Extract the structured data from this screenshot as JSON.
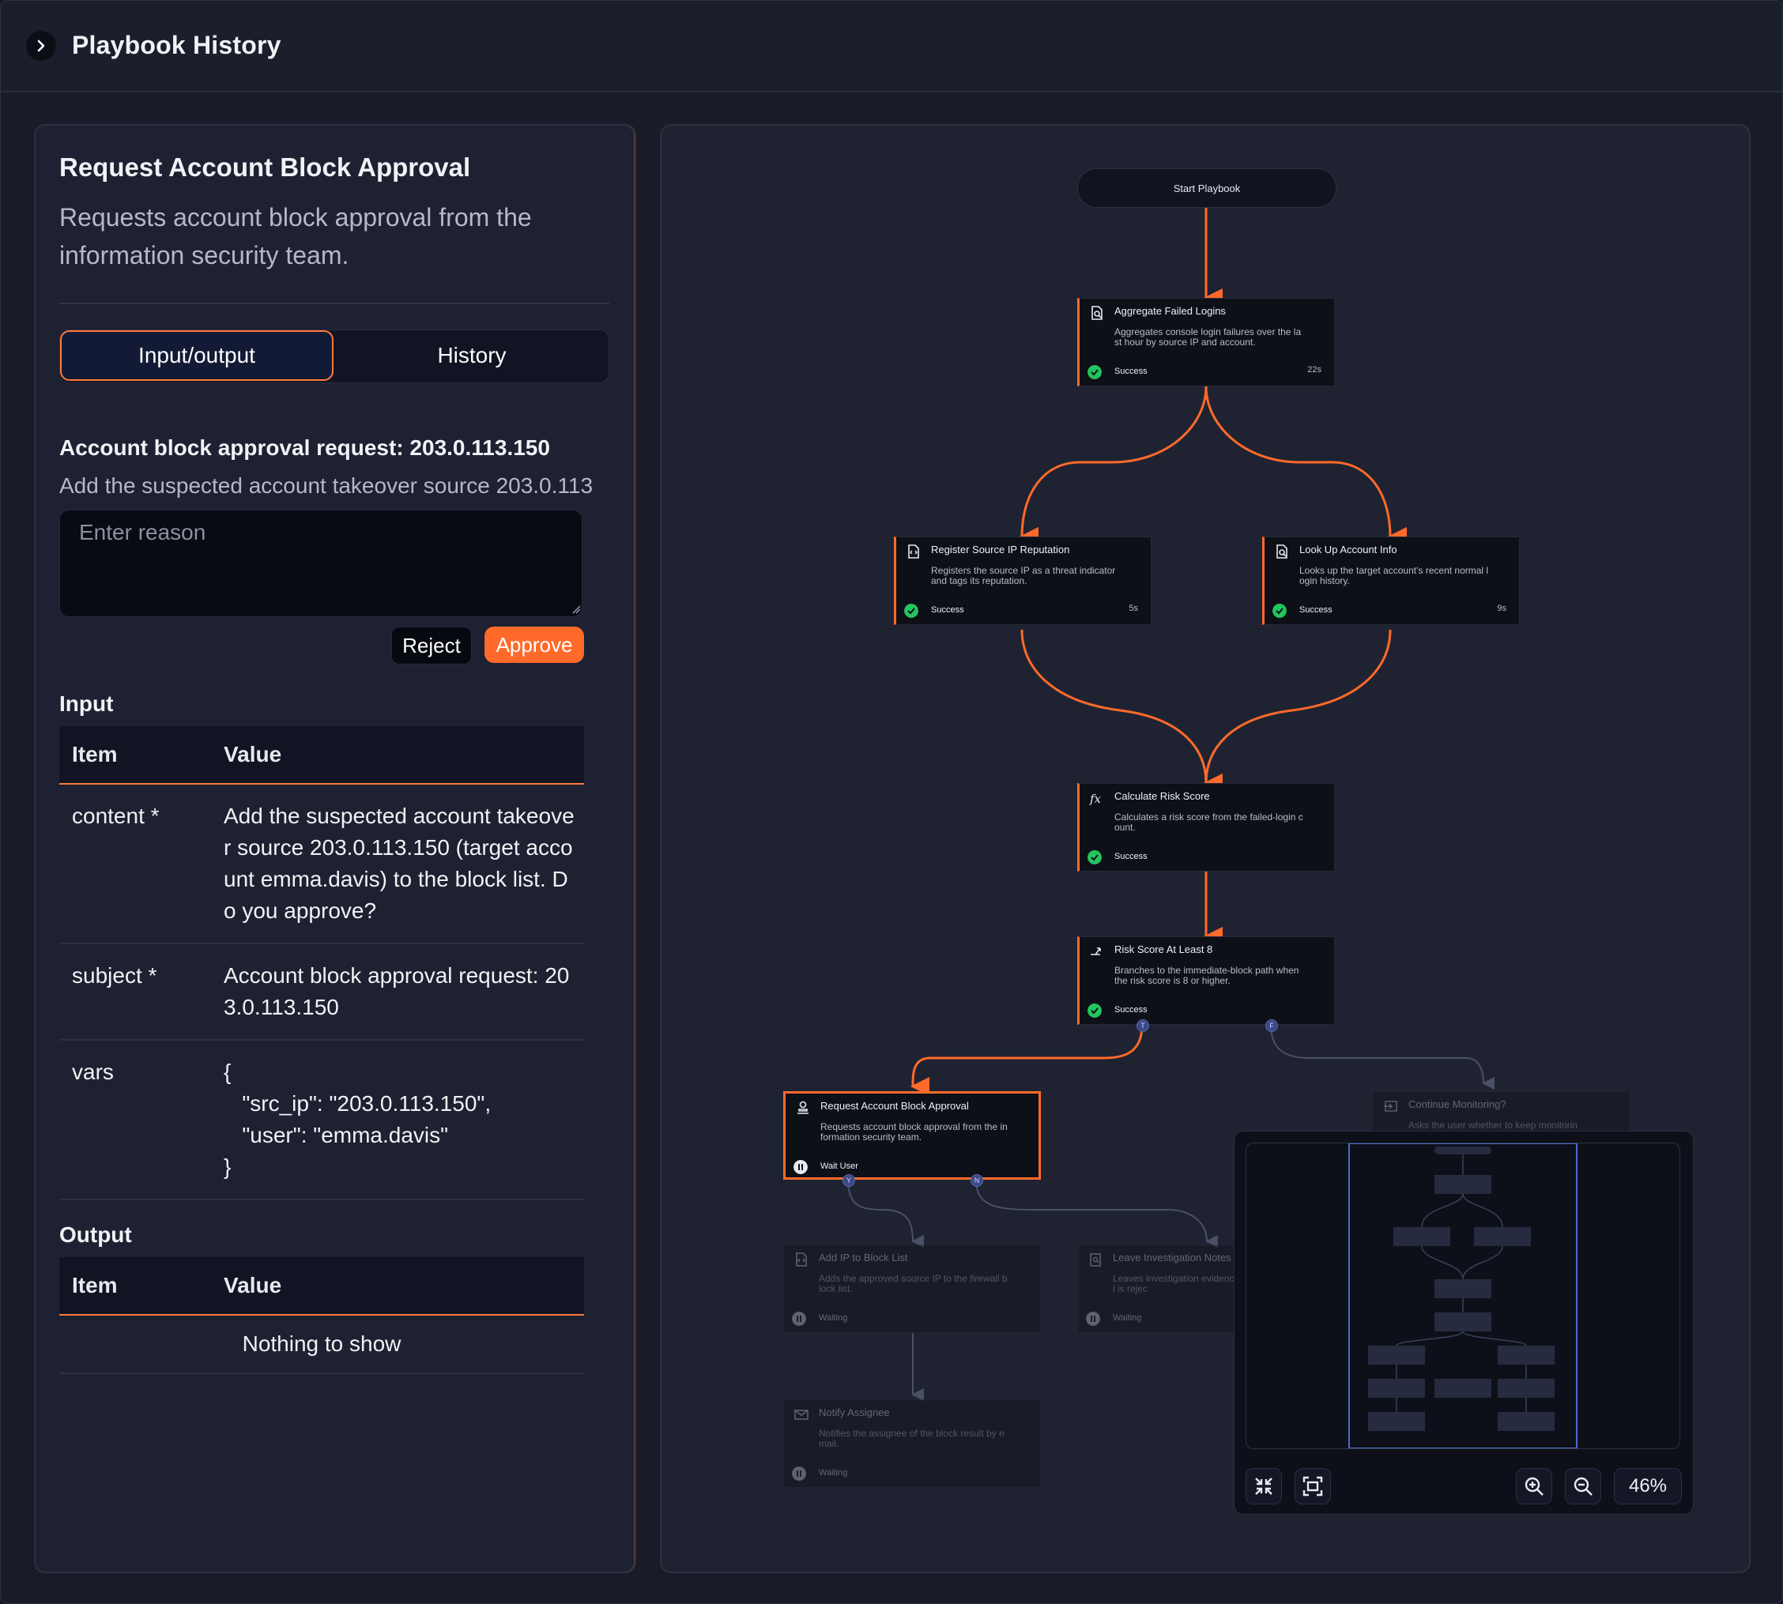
{
  "header": {
    "title": "Playbook History"
  },
  "left": {
    "title": "Request Account Block Approval",
    "description": "Requests account block approval from the information security team.",
    "tabs": [
      "Input/output",
      "History"
    ],
    "request_title": "Account block approval request: 203.0.113.150",
    "request_text": "Add the suspected account takeover source 203.0.113",
    "reason_placeholder": "Enter reason",
    "reject_label": "Reject",
    "approve_label": "Approve",
    "input_label": "Input",
    "output_label": "Output",
    "col_item": "Item",
    "col_value": "Value",
    "input_rows": [
      {
        "key": "content *",
        "value": "Add the suspected account takeover source 203.0.113.150 (target account emma.davis) to the block list. Do you approve?"
      },
      {
        "key": "subject *",
        "value": "Account block approval request: 203.0.113.150"
      },
      {
        "key": "vars",
        "value": "{\n   \"src_ip\": \"203.0.113.150\",\n   \"user\": \"emma.davis\"\n}"
      }
    ],
    "output_empty": "Nothing to show"
  },
  "canvas": {
    "start": "Start Playbook",
    "nodes": [
      {
        "title": "Aggregate Failed Logins",
        "desc": "Aggregates console login failures over the last hour by source IP and account.",
        "status": "Success",
        "time": "22s",
        "icon": "file-search-icon"
      },
      {
        "title": "Register Source IP Reputation",
        "desc": "Registers the source IP as a threat indicator and tags its reputation.",
        "status": "Success",
        "time": "5s",
        "icon": "file-code-icon"
      },
      {
        "title": "Look Up Account Info",
        "desc": "Looks up the target account's recent normal login history.",
        "status": "Success",
        "time": "9s",
        "icon": "file-search-icon"
      },
      {
        "title": "Calculate Risk Score",
        "desc": "Calculates a risk score from the failed-login count.",
        "status": "Success",
        "time": "",
        "icon": "function-icon"
      },
      {
        "title": "Risk Score At Least 8",
        "desc": "Branches to the immediate-block path when the risk score is 8 or higher.",
        "status": "Success",
        "time": "",
        "icon": "branch-icon"
      },
      {
        "title": "Request Account Block Approval",
        "desc": "Requests account block approval from the information security team.",
        "status": "Wait User",
        "time": "",
        "icon": "user-approval-icon"
      },
      {
        "title": "Continue Monitoring?",
        "desc": "Asks the user whether to keep monitorin",
        "status": "",
        "time": "",
        "icon": "arrow-in-box-icon"
      },
      {
        "title": "Add IP to Block List",
        "desc": "Adds the approved source IP to the firewall block list.",
        "status": "Waiting",
        "time": "",
        "icon": "file-code-icon"
      },
      {
        "title": "Leave Investigation Notes",
        "desc": "Leaves investigation evidence when approval is rejec",
        "status": "Waiting",
        "time": "",
        "icon": "clipboard-search-icon"
      },
      {
        "title": "Notify Assignee",
        "desc": "Notifies the assignee of the block result by email.",
        "status": "Waiting",
        "time": "",
        "icon": "mail-icon"
      }
    ],
    "ports": {
      "true": "T",
      "false": "F",
      "yes": "Y",
      "no": "N"
    },
    "zoom": "46%",
    "colors": {
      "accent": "#ff6a2a",
      "success": "#22c55e",
      "port": "#3b4a86"
    }
  }
}
